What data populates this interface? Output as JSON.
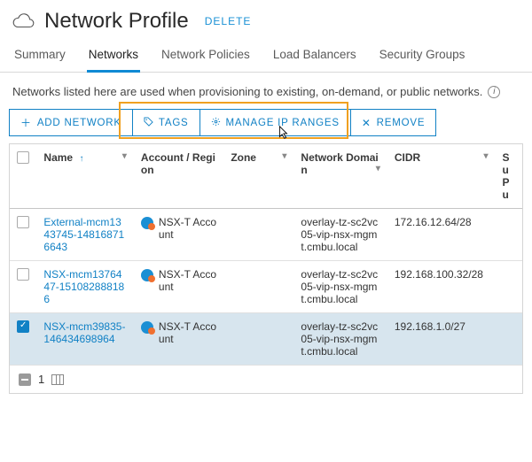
{
  "header": {
    "title": "Network Profile",
    "delete": "DELETE"
  },
  "tabs": {
    "summary": "Summary",
    "networks": "Networks",
    "policies": "Network Policies",
    "lb": "Load Balancers",
    "sg": "Security Groups"
  },
  "description": "Networks listed here are used when provisioning to existing, on-demand, or public networks.",
  "toolbar": {
    "add": "ADD NETWORK",
    "tags": "TAGS",
    "manage": "MANAGE IP RANGES",
    "remove": "REMOVE"
  },
  "columns": {
    "name": "Name",
    "account": "Account / Region",
    "zone": "Zone",
    "domain": "Network Domain",
    "cidr": "CIDR",
    "support": "Su\nPu"
  },
  "rows": [
    {
      "checked": false,
      "name": "External-mcm1343745-148168716643",
      "account": "NSX-T Account",
      "zone": "",
      "domain": "overlay-tz-sc2vc05-vip-nsx-mgmt.cmbu.local",
      "cidr": "172.16.12.64/28"
    },
    {
      "checked": false,
      "name": "NSX-mcm1376447-151082888186",
      "account": "NSX-T Account",
      "zone": "",
      "domain": "overlay-tz-sc2vc05-vip-nsx-mgmt.cmbu.local",
      "cidr": "192.168.100.32/28"
    },
    {
      "checked": true,
      "name": "NSX-mcm39835-146434698964",
      "account": "NSX-T Account",
      "zone": "",
      "domain": "overlay-tz-sc2vc05-vip-nsx-mgmt.cmbu.local",
      "cidr": "192.168.1.0/27"
    }
  ],
  "footer": {
    "count": "1"
  }
}
